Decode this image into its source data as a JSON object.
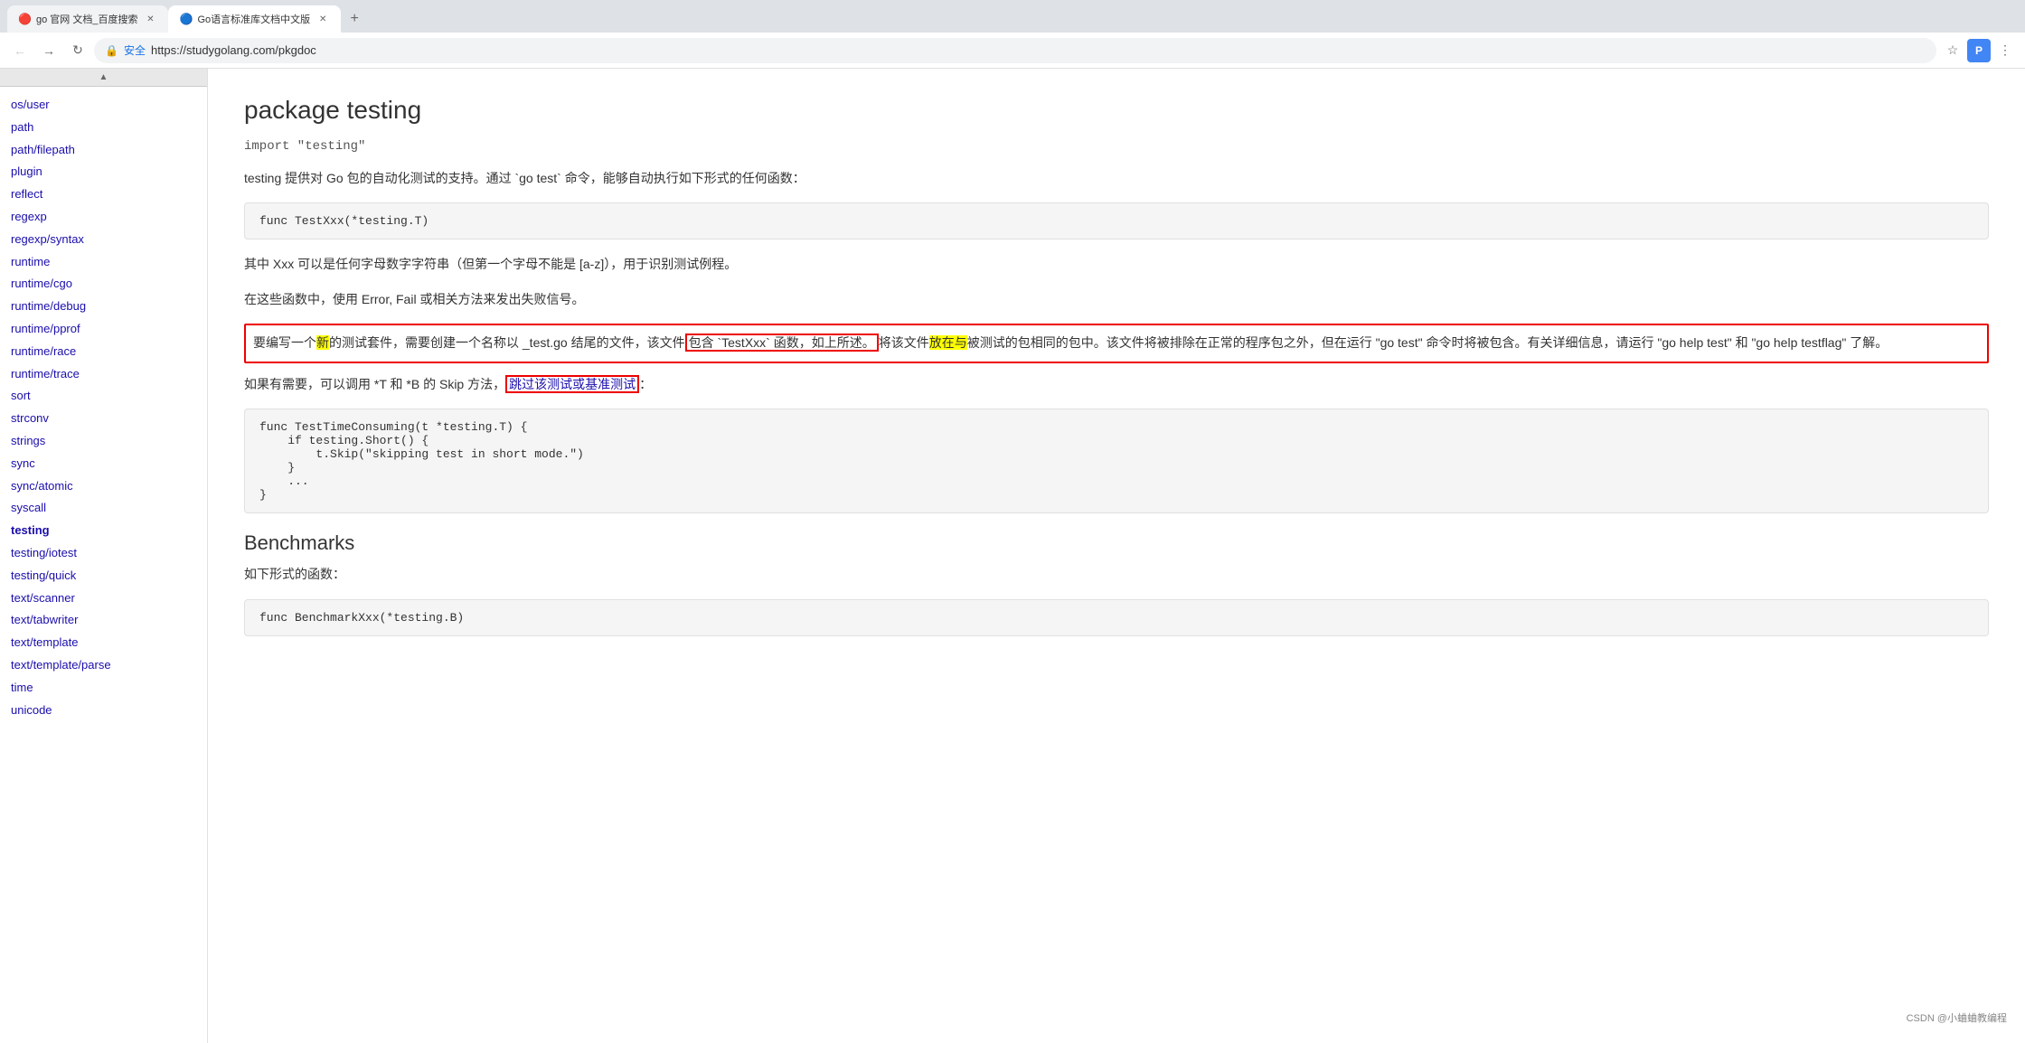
{
  "browser": {
    "tabs": [
      {
        "id": "tab1",
        "favicon": "🔴",
        "title": "go 官网 文档_百度搜索",
        "active": false,
        "closeable": true
      },
      {
        "id": "tab2",
        "favicon": "🔵",
        "title": "Go语言标准库文档中文版",
        "active": true,
        "closeable": true
      }
    ],
    "new_tab_label": "+",
    "back_label": "←",
    "forward_label": "→",
    "refresh_label": "↻",
    "home_label": "⌂",
    "lock_label": "🔒",
    "address": "https://studygolang.com/pkgdoc",
    "security_label": "安全",
    "star_label": "☆",
    "menu_label": "⋮"
  },
  "sidebar": {
    "scroll_up_label": "▲",
    "items": [
      {
        "label": "os/user",
        "href": "#",
        "active": false
      },
      {
        "label": "path",
        "href": "#",
        "active": false
      },
      {
        "label": "path/filepath",
        "href": "#",
        "active": false
      },
      {
        "label": "plugin",
        "href": "#",
        "active": false
      },
      {
        "label": "reflect",
        "href": "#",
        "active": false
      },
      {
        "label": "regexp",
        "href": "#",
        "active": false
      },
      {
        "label": "regexp/syntax",
        "href": "#",
        "active": false
      },
      {
        "label": "runtime",
        "href": "#",
        "active": false
      },
      {
        "label": "runtime/cgo",
        "href": "#",
        "active": false
      },
      {
        "label": "runtime/debug",
        "href": "#",
        "active": false
      },
      {
        "label": "runtime/pprof",
        "href": "#",
        "active": false
      },
      {
        "label": "runtime/race",
        "href": "#",
        "active": false
      },
      {
        "label": "runtime/trace",
        "href": "#",
        "active": false
      },
      {
        "label": "sort",
        "href": "#",
        "active": false
      },
      {
        "label": "strconv",
        "href": "#",
        "active": false
      },
      {
        "label": "strings",
        "href": "#",
        "active": false
      },
      {
        "label": "sync",
        "href": "#",
        "active": false
      },
      {
        "label": "sync/atomic",
        "href": "#",
        "active": false
      },
      {
        "label": "syscall",
        "href": "#",
        "active": false
      },
      {
        "label": "testing",
        "href": "#",
        "active": true
      },
      {
        "label": "testing/iotest",
        "href": "#",
        "active": false
      },
      {
        "label": "testing/quick",
        "href": "#",
        "active": false
      },
      {
        "label": "text/scanner",
        "href": "#",
        "active": false
      },
      {
        "label": "text/tabwriter",
        "href": "#",
        "active": false
      },
      {
        "label": "text/template",
        "href": "#",
        "active": false
      },
      {
        "label": "text/template/parse",
        "href": "#",
        "active": false
      },
      {
        "label": "time",
        "href": "#",
        "active": false
      },
      {
        "label": "unicode",
        "href": "#",
        "active": false
      }
    ]
  },
  "content": {
    "package_prefix": "package ",
    "package_name": "testing",
    "import_line": "import \"testing\"",
    "description1": "testing 提供对 Go 包的自动化测试的支持。通过 `go test` 命令，能够自动执行如下形式的任何函数：",
    "code1": "func TestXxx(*testing.T)",
    "description2": "其中 Xxx 可以是任何字母数字字符串（但第一个字母不能是 [a-z]），用于识别测试例程。",
    "description3": "在这些函数中，使用 Error, Fail 或相关方法来发出失败信号。",
    "highlighted_text_line1": "要编写一个新的测试套件，需要创建一个名称以 _test.go 结尾的文件，该文件包含 `TestXxx` 函数，如上所述。将该文件放在与被测试的包相同的包中。该文件将被排除在正常的程序包之外，但在运行 \"go test\" 命令时将被包含。有关详细信息，请运行 \"go help test\" 和 \"go help testflag\" 了解。",
    "description4_pre": "如果有需要，可以调用 *T 和 *B 的 Skip 方法，",
    "description4_link": "跳过该测试或基准测试",
    "description4_post": "：",
    "code2_lines": [
      "func TestTimeConsuming(t *testing.T) {",
      "    if testing.Short() {",
      "        t.Skip(\"skipping test in short mode.\")",
      "    }",
      "    ...",
      "}"
    ],
    "benchmarks_title": "Benchmarks",
    "benchmarks_desc": "如下形式的函数：",
    "code3": "func BenchmarkXxx(*testing.B)",
    "watermark": "CSDN @小蛐蛐教编程"
  }
}
